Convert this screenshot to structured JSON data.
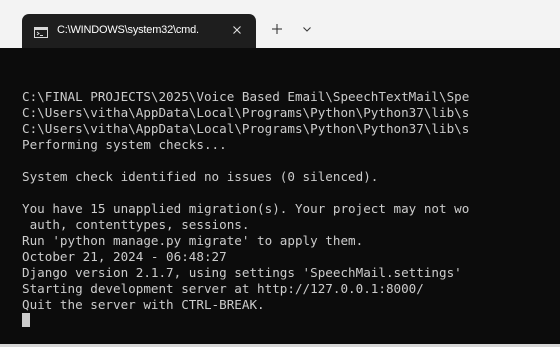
{
  "window": {
    "tab_title": "C:\\WINDOWS\\system32\\cmd.",
    "tab_icon": "cmd-prompt-icon",
    "close_icon": "close-icon",
    "new_tab_icon": "plus-icon",
    "dropdown_icon": "chevron-down-icon"
  },
  "terminal": {
    "lines": [
      "",
      "C:\\FINAL PROJECTS\\2025\\Voice Based Email\\SpeechTextMail\\Spe",
      "C:\\Users\\vitha\\AppData\\Local\\Programs\\Python\\Python37\\lib\\s",
      "C:\\Users\\vitha\\AppData\\Local\\Programs\\Python\\Python37\\lib\\s",
      "Performing system checks...",
      "",
      "System check identified no issues (0 silenced).",
      "",
      "You have 15 unapplied migration(s). Your project may not wo",
      " auth, contenttypes, sessions.",
      "Run 'python manage.py migrate' to apply them.",
      "October 21, 2024 - 06:48:27",
      "Django version 2.1.7, using settings 'SpeechMail.settings'",
      "Starting development server at http://127.0.0.1:8000/",
      "Quit the server with CTRL-BREAK."
    ]
  },
  "colors": {
    "titlebar": "#f3f3f3",
    "tab": "#1e1e1e",
    "terminal_bg": "#0c0c0c",
    "terminal_text": "#cccccc"
  }
}
